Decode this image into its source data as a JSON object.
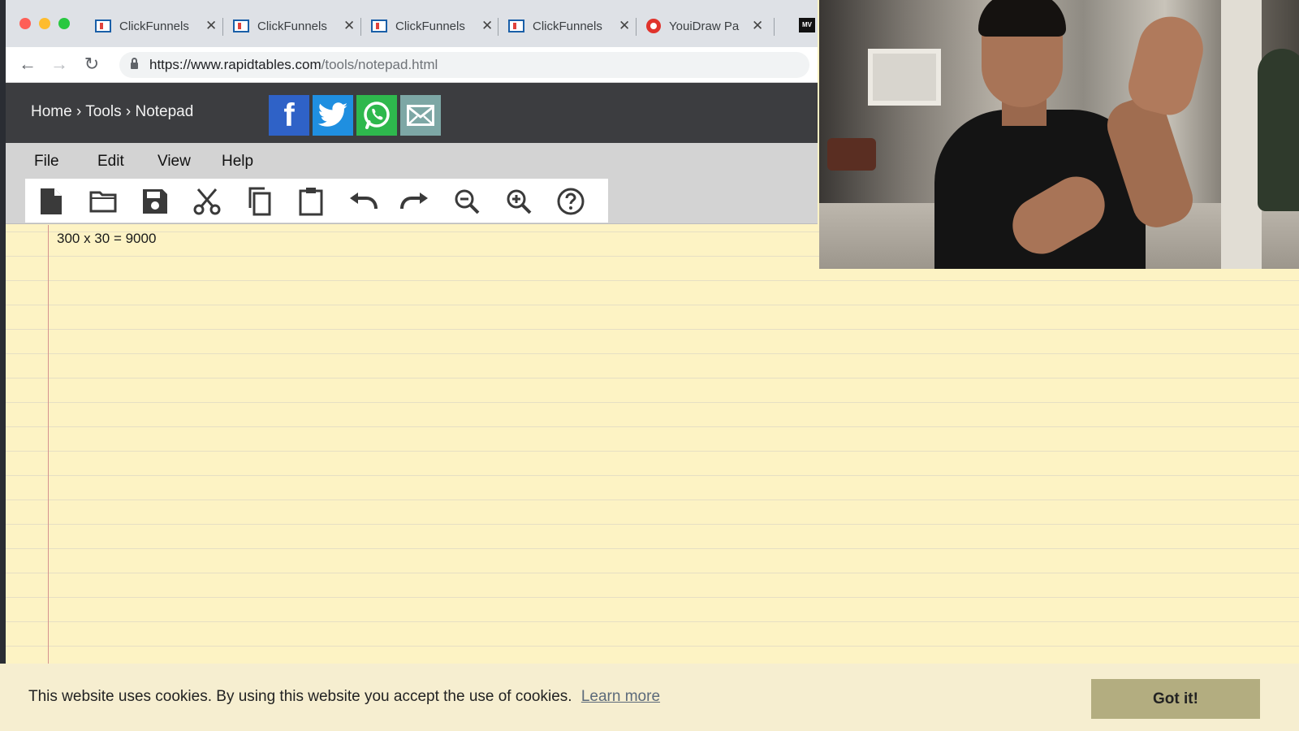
{
  "browser": {
    "tabs": [
      {
        "label": "ClickFunnels",
        "favicon": "clickfunnels-favicon"
      },
      {
        "label": "ClickFunnels",
        "favicon": "clickfunnels-favicon"
      },
      {
        "label": "ClickFunnels",
        "favicon": "clickfunnels-favicon"
      },
      {
        "label": "ClickFunnels",
        "favicon": "clickfunnels-favicon"
      },
      {
        "label": "YouiDraw Pa",
        "favicon": "youidraw-favicon"
      }
    ],
    "extra_tab_badge": "MV",
    "url_host": "https://www.rapidtables.com",
    "url_path": "/tools/notepad.html"
  },
  "site": {
    "breadcrumb": {
      "home": "Home",
      "tools": "Tools",
      "current": "Notepad",
      "separator": "›"
    },
    "share": {
      "facebook": "f"
    }
  },
  "menu": {
    "file": "File",
    "edit": "Edit",
    "view": "View",
    "help": "Help"
  },
  "toolbar": {
    "icons": [
      "new-file-icon",
      "open-folder-icon",
      "save-icon",
      "cut-icon",
      "copy-icon",
      "paste-icon",
      "undo-icon",
      "redo-icon",
      "zoom-out-icon",
      "zoom-in-icon",
      "help-icon"
    ]
  },
  "notepad": {
    "content": "300 x 30 = 9000"
  },
  "cookie": {
    "message": "This website uses cookies. By using this website you accept the use of cookies.",
    "link": "Learn more",
    "button": "Got it!"
  },
  "colors": {
    "header_bg": "#3c3d40",
    "facebook": "#2f62c7",
    "twitter": "#1f8fe0",
    "whatsapp": "#2eb84d",
    "email": "#7da7a5",
    "paper": "#fdf3c4",
    "cookie_button": "#b3ad80"
  }
}
